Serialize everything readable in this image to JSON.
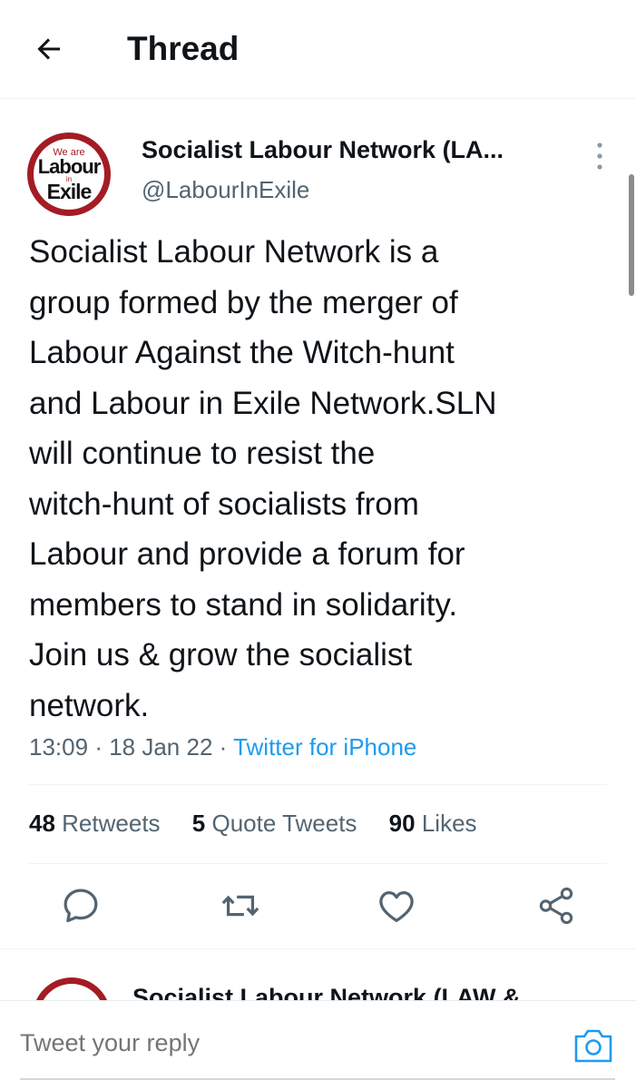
{
  "header": {
    "title": "Thread",
    "back_icon": "arrow-left-icon"
  },
  "tweet": {
    "author": {
      "display_name": "Socialist Labour Network (LA...",
      "handle": "@LabourInExile",
      "avatar_text": {
        "top": "We are",
        "main": "Labour",
        "middle": "in",
        "bottom": "Exile"
      }
    },
    "text_lines": [
      "Socialist Labour Network is a",
      "group formed by the merger of",
      "Labour Against the Witch-hunt",
      "and Labour in Exile Network.SLN",
      "will continue to resist the",
      "witch-hunt of socialists from",
      "Labour and provide a forum for",
      "members to stand in solidarity.",
      "Join us & grow the socialist",
      "network."
    ],
    "time": "13:09",
    "date": "18 Jan 22",
    "source": "Twitter for iPhone",
    "stats": {
      "retweets_count": "48",
      "retweets_label": "Retweets",
      "quotes_count": "5",
      "quotes_label": "Quote Tweets",
      "likes_count": "90",
      "likes_label": "Likes"
    },
    "actions": [
      "reply-icon",
      "retweet-icon",
      "like-icon",
      "share-icon"
    ]
  },
  "next_tweet": {
    "display_name": "Socialist Labour Network (LAW &"
  },
  "reply": {
    "placeholder": "Tweet your reply",
    "camera_icon": "camera-icon"
  },
  "colors": {
    "accent": "#1d9bf0",
    "text": "#0f1419",
    "secondary": "#536471",
    "logo_red": "#a31c24"
  }
}
